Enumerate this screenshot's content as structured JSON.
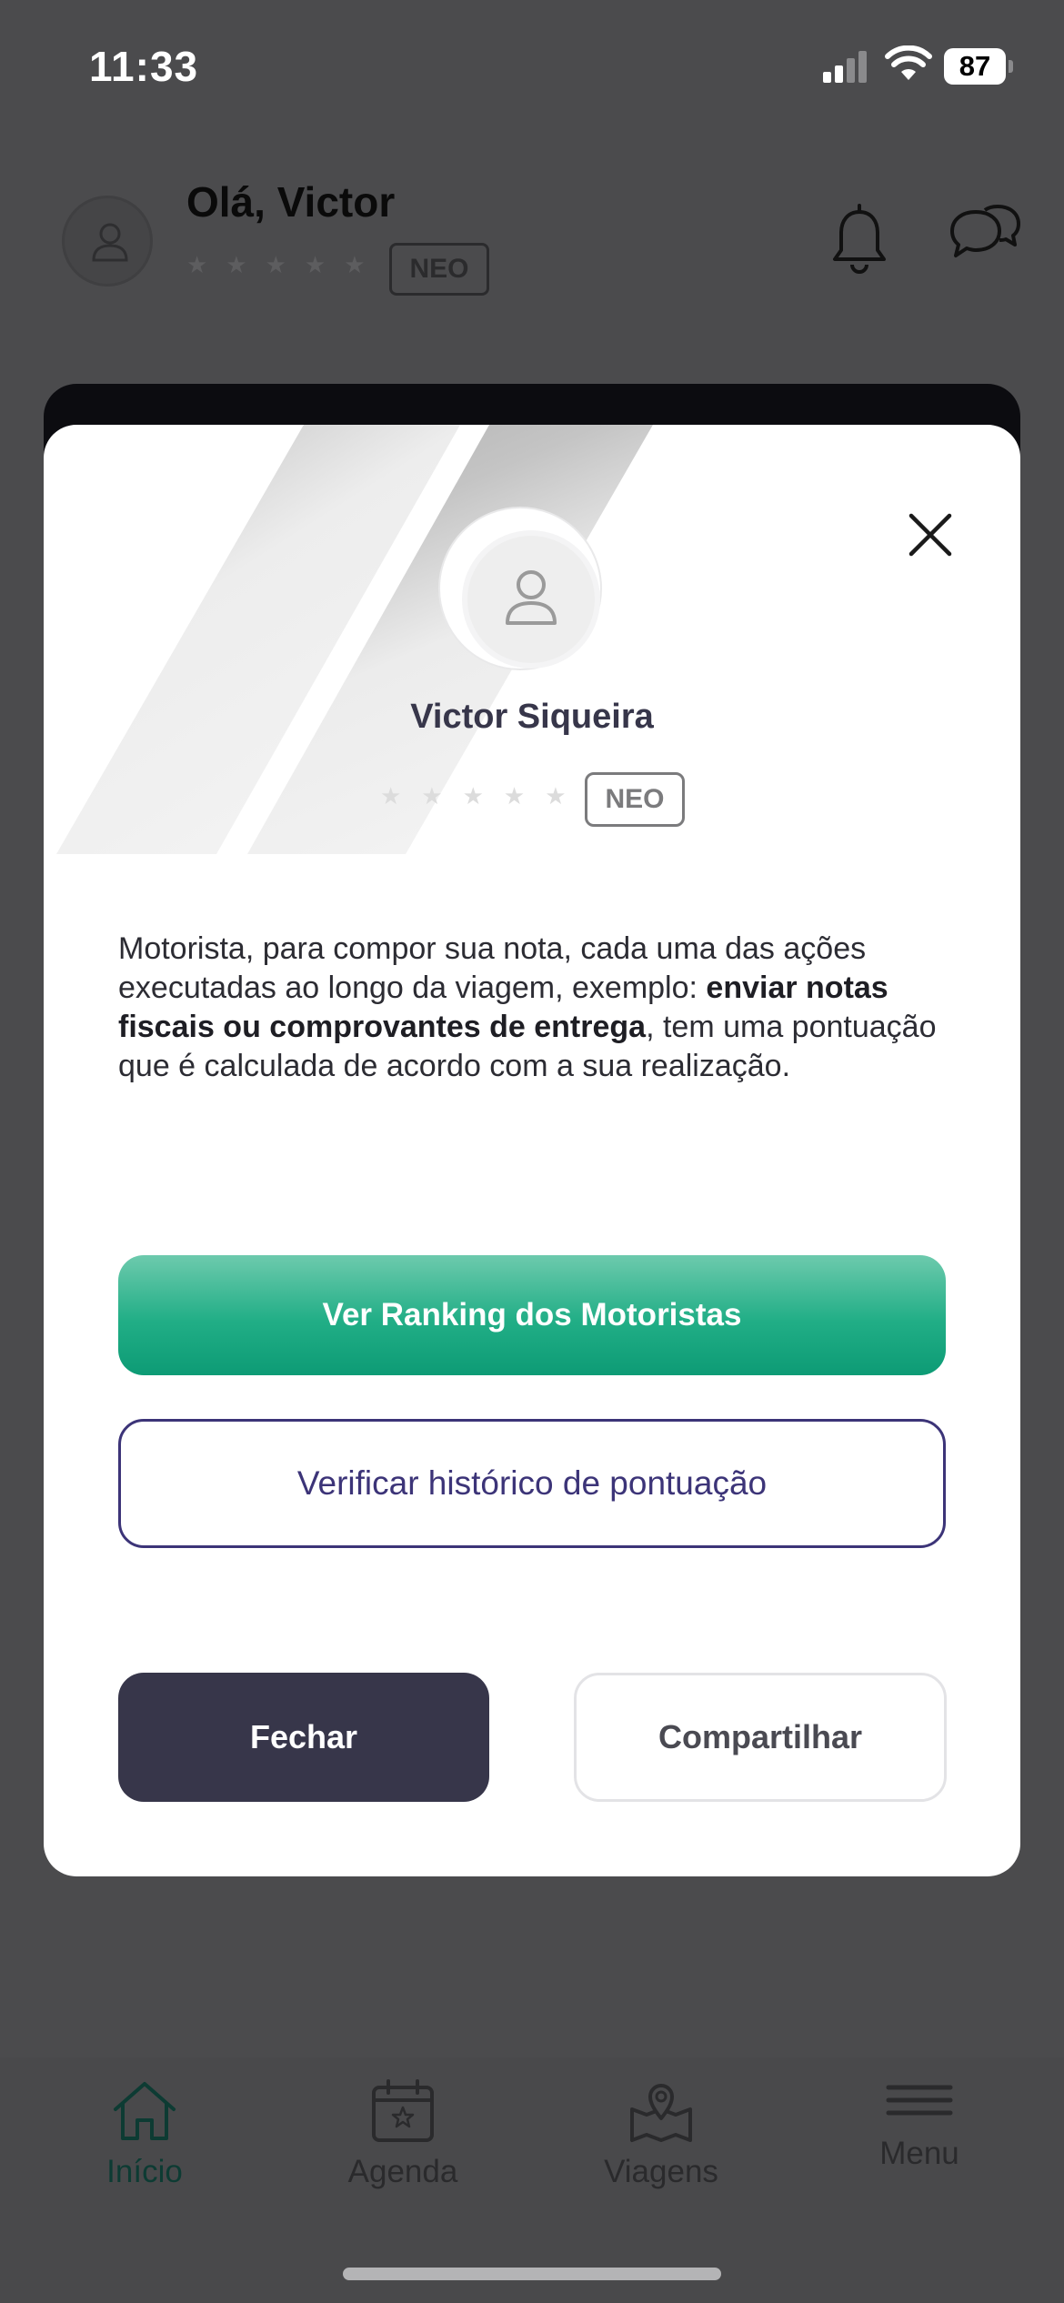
{
  "status_bar": {
    "time": "11:33",
    "battery": "87"
  },
  "header": {
    "greeting": "Olá, Victor",
    "stars": "★★★★★",
    "badge": "NEO"
  },
  "modal": {
    "name": "Victor Siqueira",
    "stars": "★★★★★",
    "badge": "NEO",
    "description_part1": "Motorista, para compor sua nota, cada uma das ações executadas ao longo da viagem, exemplo: ",
    "description_bold": "enviar notas fiscais ou comprovantes de entrega",
    "description_part2": ", tem uma pontuação que é calculada de acordo com a sua realização.",
    "ranking_button": "Ver Ranking dos Motoristas",
    "history_button": "Verificar histórico de pontuação",
    "close_button": "Fechar",
    "share_button": "Compartilhar"
  },
  "bottom_nav": {
    "items": [
      {
        "label": "Início",
        "icon": "home-icon"
      },
      {
        "label": "Agenda",
        "icon": "calendar-icon"
      },
      {
        "label": "Viagens",
        "icon": "map-pin-icon"
      },
      {
        "label": "Menu",
        "icon": "hamburger-icon"
      }
    ]
  },
  "colors": {
    "overlay": "#4b4b4d",
    "primary_green": "#21ae86",
    "dark_button": "#37364a",
    "outline_purple": "#3c3478"
  }
}
